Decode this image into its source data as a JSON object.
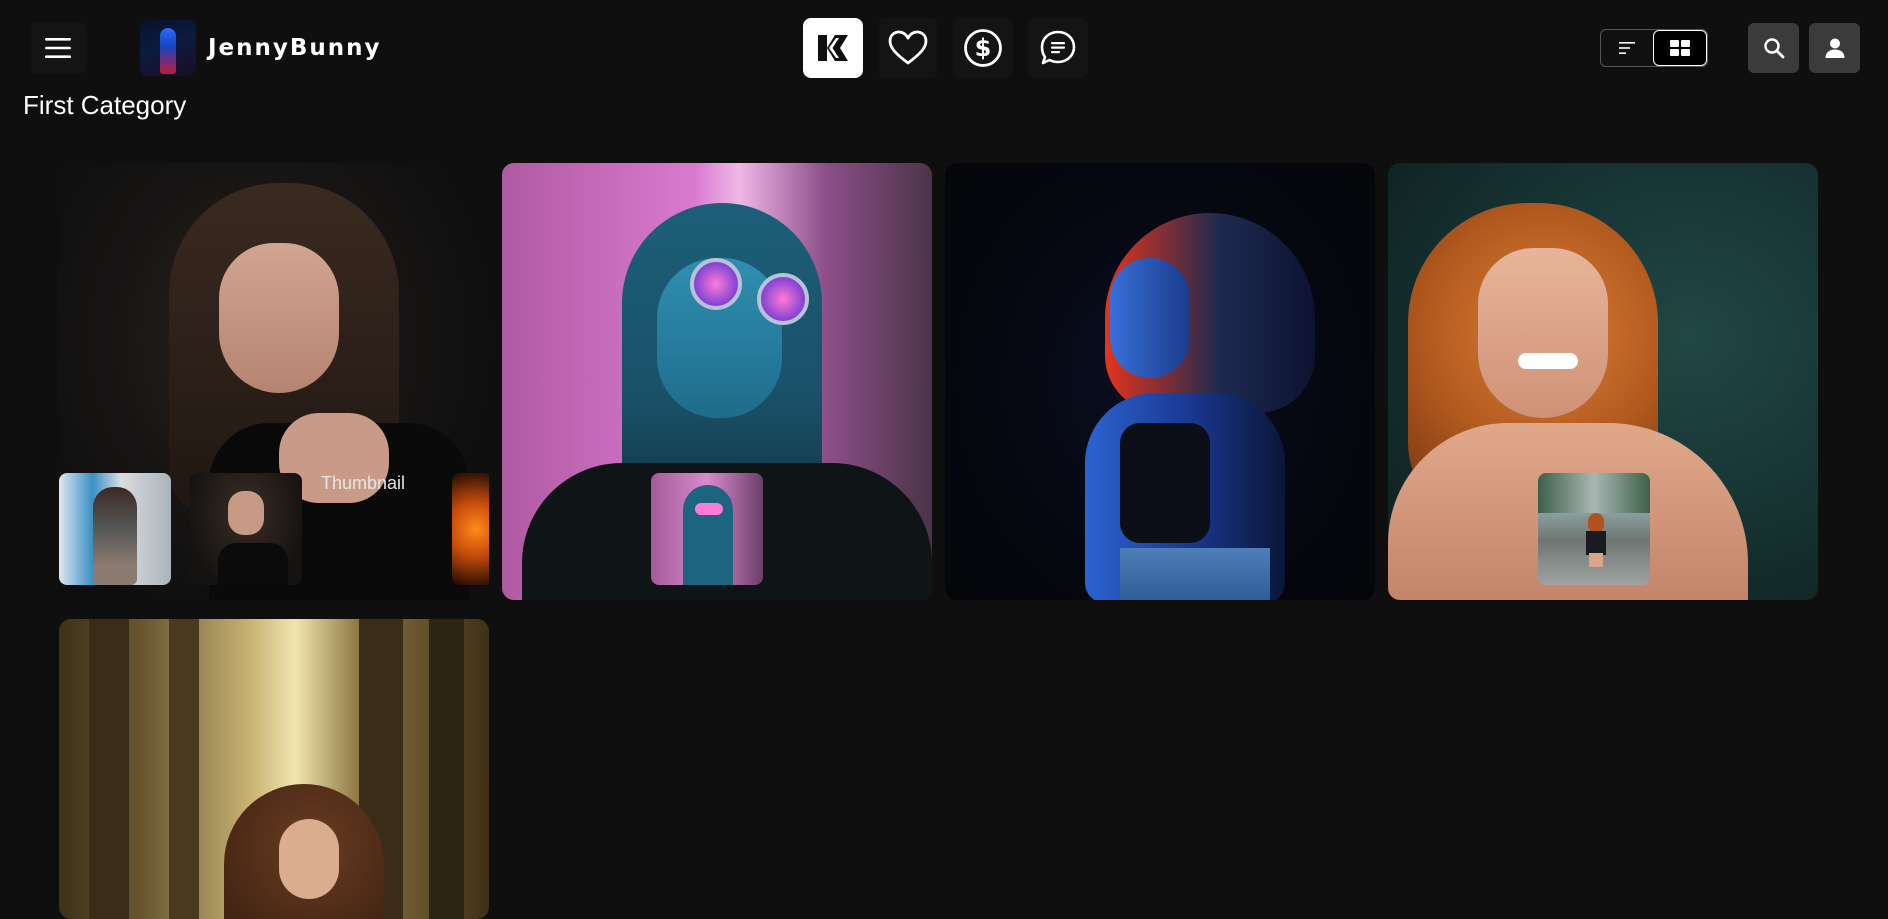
{
  "header": {
    "brand_name": "JennyBunny",
    "menu_icon": "hamburger-menu-icon",
    "nav_icons": [
      "brand-logo-icon",
      "heart-icon",
      "dollar-circle-icon",
      "chat-bubble-icon"
    ],
    "view_toggle": [
      "list-view-icon",
      "grid-view-icon"
    ],
    "view_selected": "grid",
    "search_icon": "search-icon",
    "user_icon": "user-icon"
  },
  "section": {
    "title": "First Category"
  },
  "gallery": {
    "card_count": 5,
    "broken_thumbnail_alt": "Thumbnail"
  },
  "colors": {
    "background": "#0f0f0f",
    "button": "#141414",
    "icon_button": "#3b3b3b",
    "active": "#ffffff"
  }
}
